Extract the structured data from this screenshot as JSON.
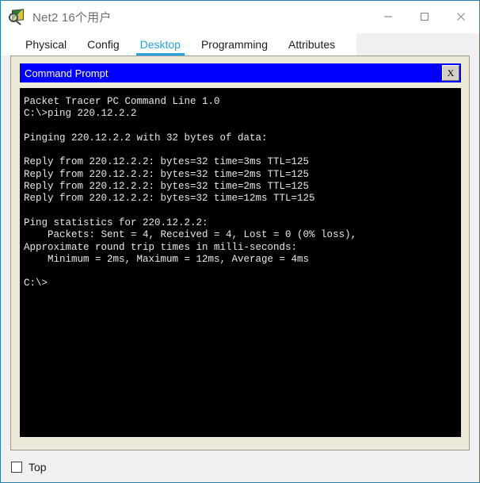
{
  "window": {
    "title": "Net2 16个用户",
    "icon": "packet-tracer-icon",
    "controls": {
      "minimize": "minimize-icon",
      "maximize": "maximize-icon",
      "close": "close-icon"
    }
  },
  "tabs": [
    {
      "label": "Physical",
      "active": false
    },
    {
      "label": "Config",
      "active": false
    },
    {
      "label": "Desktop",
      "active": true
    },
    {
      "label": "Programming",
      "active": false
    },
    {
      "label": "Attributes",
      "active": false
    }
  ],
  "command_prompt": {
    "title": "Command Prompt",
    "close_label": "X",
    "terminal_text": "Packet Tracer PC Command Line 1.0\nC:\\>ping 220.12.2.2\n\nPinging 220.12.2.2 with 32 bytes of data:\n\nReply from 220.12.2.2: bytes=32 time=3ms TTL=125\nReply from 220.12.2.2: bytes=32 time=2ms TTL=125\nReply from 220.12.2.2: bytes=32 time=2ms TTL=125\nReply from 220.12.2.2: bytes=32 time=12ms TTL=125\n\nPing statistics for 220.12.2.2:\n    Packets: Sent = 4, Received = 4, Lost = 0 (0% loss),\nApproximate round trip times in milli-seconds:\n    Minimum = 2ms, Maximum = 12ms, Average = 4ms\n\nC:\\>",
    "lines": [
      "Packet Tracer PC Command Line 1.0",
      "C:\\>ping 220.12.2.2",
      "",
      "Pinging 220.12.2.2 with 32 bytes of data:",
      "",
      "Reply from 220.12.2.2: bytes=32 time=3ms TTL=125",
      "Reply from 220.12.2.2: bytes=32 time=2ms TTL=125",
      "Reply from 220.12.2.2: bytes=32 time=2ms TTL=125",
      "Reply from 220.12.2.2: bytes=32 time=12ms TTL=125",
      "",
      "Ping statistics for 220.12.2.2:",
      "    Packets: Sent = 4, Received = 4, Lost = 0 (0% loss),",
      "Approximate round trip times in milli-seconds:",
      "    Minimum = 2ms, Maximum = 12ms, Average = 4ms",
      "",
      "C:\\>"
    ],
    "ping_target": "220.12.2.2",
    "bytes": "32",
    "ttl": "125",
    "reply_times": [
      "3ms",
      "2ms",
      "2ms",
      "12ms"
    ],
    "packets_sent": "4",
    "packets_received": "4",
    "packets_lost": "0",
    "loss_percent": "0%",
    "minimum": "2ms",
    "maximum": "12ms",
    "average": "4ms"
  },
  "bottom": {
    "top_checkbox_label": "Top",
    "top_checkbox_checked": false
  },
  "colors": {
    "cmd_titlebar": "#0000ff",
    "panel_background": "#ece9d8",
    "terminal_background": "#000000",
    "terminal_text": "#e8e8e8",
    "active_tab": "#29a3df",
    "window_border": "#2e7ba6"
  }
}
